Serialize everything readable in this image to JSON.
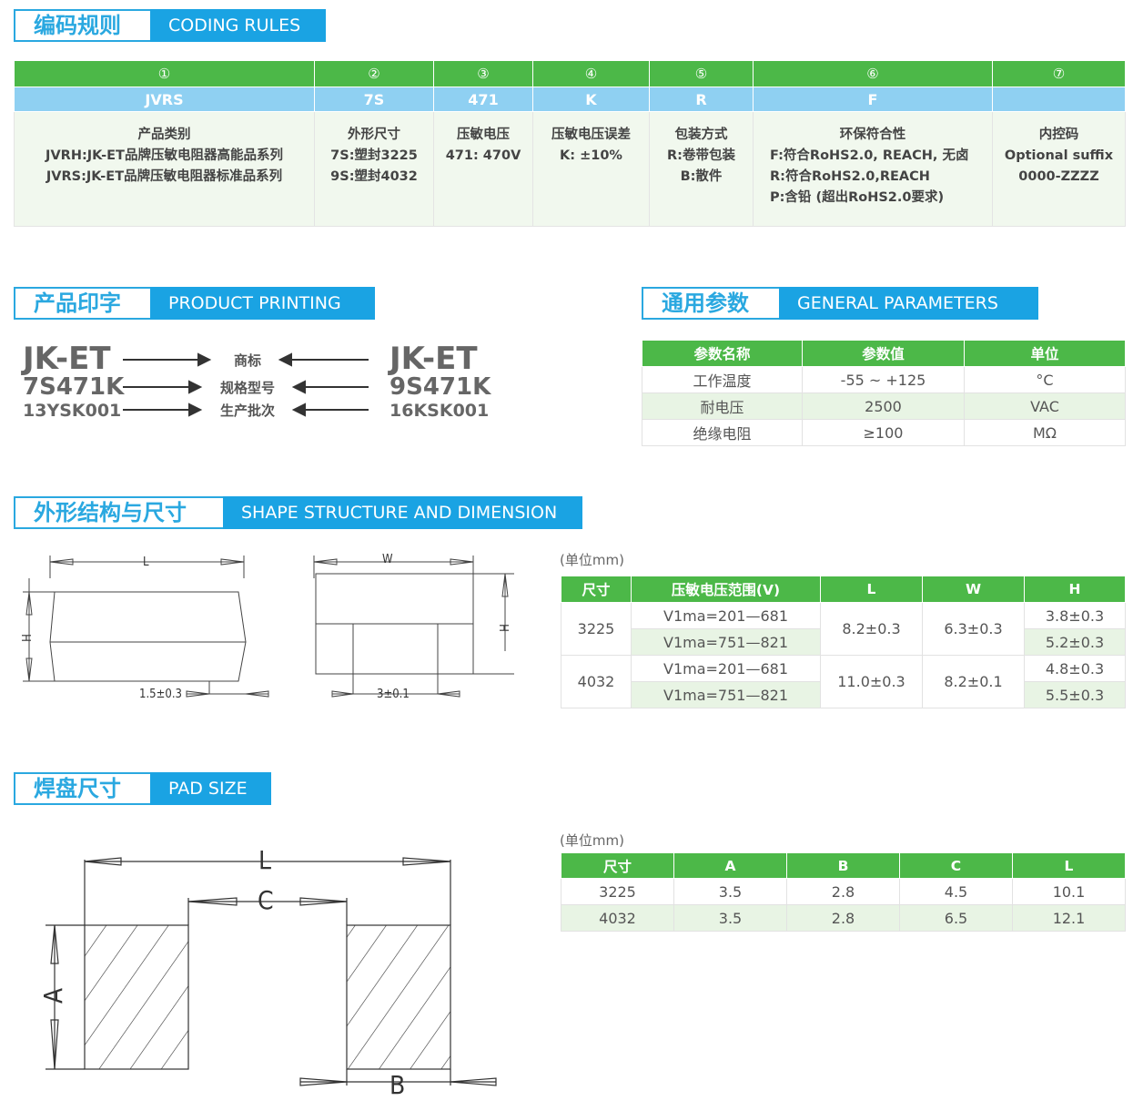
{
  "coding": {
    "title_zh": "编码规则",
    "title_en": "CODING RULES",
    "nums": [
      "①",
      "②",
      "③",
      "④",
      "⑤",
      "⑥",
      "⑦"
    ],
    "codes": [
      "JVRS",
      "7S",
      "471",
      "K",
      "R",
      "F",
      ""
    ],
    "desc": [
      [
        "产品类别",
        "JVRH:JK-ET品牌压敏电阻器高能品系列",
        "JVRS:JK-ET品牌压敏电阻器标准品系列"
      ],
      [
        "外形尺寸",
        "7S:塑封3225",
        "9S:塑封4032"
      ],
      [
        "压敏电压",
        "471: 470V"
      ],
      [
        "压敏电压误差",
        "K: ±10%"
      ],
      [
        "包装方式",
        "R:卷带包装",
        "B:散件"
      ],
      [
        "环保符合性",
        "F:符合RoHS2.0, REACH, 无卤",
        "R:符合RoHS2.0,REACH",
        "P:含铅 (超出RoHS2.0要求)"
      ],
      [
        "内控码",
        "Optional suffix",
        "0000-ZZZZ"
      ]
    ]
  },
  "printing": {
    "title_zh": "产品印字",
    "title_en": "PRODUCT PRINTING",
    "left": [
      "JK-ET",
      "7S471K",
      "13YSK001"
    ],
    "right": [
      "JK-ET",
      "9S471K",
      "16KSK001"
    ],
    "labels": [
      "商标",
      "规格型号",
      "生产批次"
    ]
  },
  "general": {
    "title_zh": "通用参数",
    "title_en": "GENERAL PARAMETERS",
    "headers": [
      "参数名称",
      "参数值",
      "单位"
    ],
    "rows": [
      [
        "工作温度",
        "-55 ~ +125",
        "°C"
      ],
      [
        "耐电压",
        "2500",
        "VAC"
      ],
      [
        "绝缘电阻",
        "≥100",
        "MΩ"
      ]
    ]
  },
  "shape": {
    "title_zh": "外形结构与尺寸",
    "title_en": "SHAPE STRUCTURE AND DIMENSION",
    "unit": "(单位mm)",
    "headers": [
      "尺寸",
      "压敏电压范围(V)",
      "L",
      "W",
      "H"
    ],
    "rows": [
      {
        "size": "3225",
        "ranges": [
          "V1ma=201—681",
          "V1ma=751—821"
        ],
        "L": "8.2±0.3",
        "W": "6.3±0.3",
        "H": [
          "3.8±0.3",
          "5.2±0.3"
        ]
      },
      {
        "size": "4032",
        "ranges": [
          "V1ma=201—681",
          "V1ma=751—821"
        ],
        "L": "11.0±0.3",
        "W": "8.2±0.1",
        "H": [
          "4.8±0.3",
          "5.5±0.3"
        ]
      }
    ],
    "drawing": {
      "L": "L",
      "H": "H",
      "W": "W",
      "H2": "H",
      "side": "1.5±0.3",
      "bottom": "3±0.1"
    }
  },
  "pad": {
    "title_zh": "焊盘尺寸",
    "title_en": "PAD SIZE",
    "unit": "(单位mm)",
    "headers": [
      "尺寸",
      "A",
      "B",
      "C",
      "L"
    ],
    "rows": [
      [
        "3225",
        "3.5",
        "2.8",
        "4.5",
        "10.1"
      ],
      [
        "4032",
        "3.5",
        "2.8",
        "6.5",
        "12.1"
      ]
    ],
    "drawing": {
      "L": "L",
      "C": "C",
      "A": "A",
      "B": "B"
    }
  }
}
